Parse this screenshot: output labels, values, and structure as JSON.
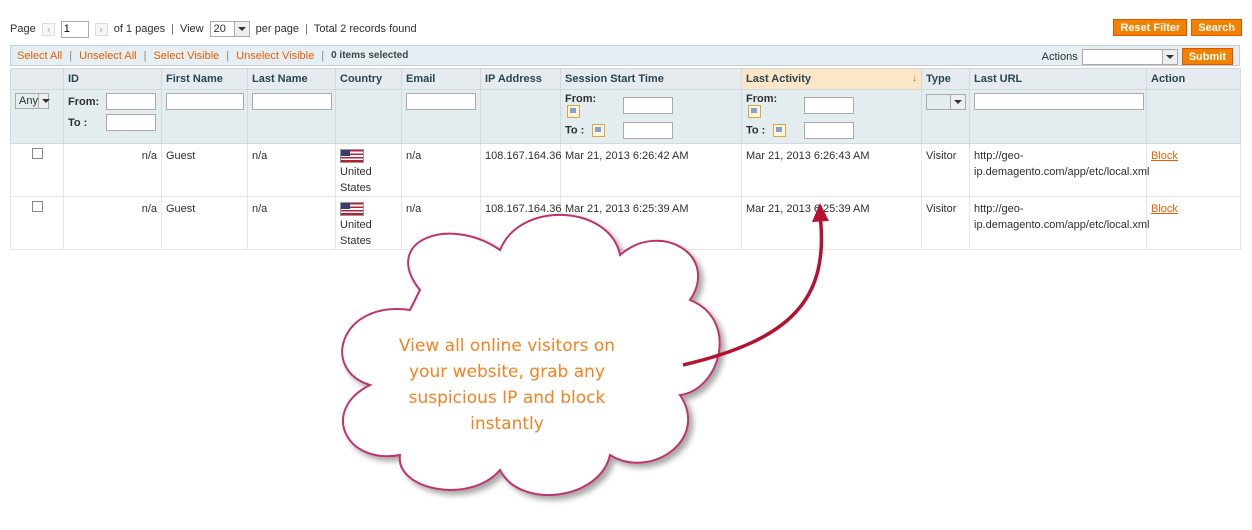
{
  "pager": {
    "page_label": "Page",
    "page_value": "1",
    "of_pages": "of 1 pages",
    "view_label": "View",
    "view_value": "20",
    "per_page": "per page",
    "total": "Total 2 records found"
  },
  "buttons": {
    "reset_filter": "Reset Filter",
    "search": "Search",
    "submit": "Submit"
  },
  "massaction": {
    "select_all": "Select All",
    "unselect_all": "Unselect All",
    "select_visible": "Select Visible",
    "unselect_visible": "Unselect Visible",
    "items_selected": "0 items selected",
    "actions_label": "Actions"
  },
  "columns": {
    "id": "ID",
    "first_name": "First Name",
    "last_name": "Last Name",
    "country": "Country",
    "email": "Email",
    "ip": "IP Address",
    "session_start": "Session Start Time",
    "last_activity": "Last Activity",
    "type": "Type",
    "last_url": "Last URL",
    "action": "Action"
  },
  "sort_arrow": "↓",
  "filters": {
    "any": "Any",
    "from": "From:",
    "to": "To :"
  },
  "rows": [
    {
      "id": "n/a",
      "first_name": "Guest",
      "last_name": "n/a",
      "country": "United States",
      "email": "n/a",
      "ip": "108.167.164.36",
      "session_start": "Mar 21, 2013 6:26:42 AM",
      "last_activity": "Mar 21, 2013 6:26:43 AM",
      "type": "Visitor",
      "url": "http://geo-ip.demagento.com/app/etc/local.xml",
      "action": "Block"
    },
    {
      "id": "n/a",
      "first_name": "Guest",
      "last_name": "n/a",
      "country": "United States",
      "email": "n/a",
      "ip": "108.167.164.36",
      "session_start": "Mar 21, 2013 6:25:39 AM",
      "last_activity": "Mar 21, 2013 6:25:39 AM",
      "type": "Visitor",
      "url": "http://geo-ip.demagento.com/app/etc/local.xml",
      "action": "Block"
    }
  ],
  "annotation": {
    "line1": "View all online visitors on",
    "line2": "your website, grab any",
    "line3": "suspicious IP and block",
    "line4": "instantly"
  },
  "colors": {
    "accent": "#f18200",
    "link": "#eb5e00",
    "cloud_border": "#c0326e",
    "cloud_text": "#f58220",
    "arrow": "#b5122f"
  }
}
